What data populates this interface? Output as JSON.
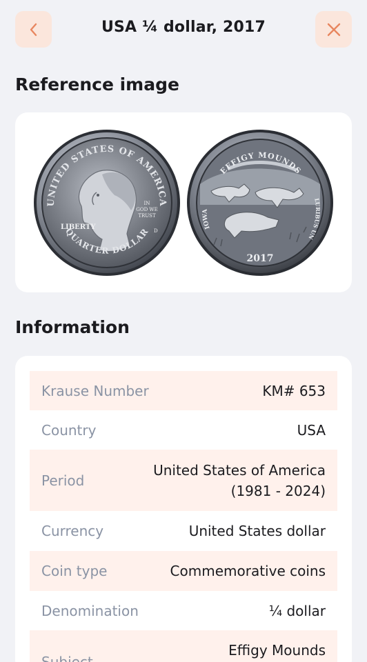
{
  "header": {
    "title": "USA ¼ dollar, 2017",
    "back_icon": "chevron-left-icon",
    "close_icon": "close-icon",
    "accent_color": "#e8865f"
  },
  "reference": {
    "section_title": "Reference image",
    "obverse": {
      "top_legend": "UNITED STATES OF AMERICA",
      "motto_1": "IN",
      "motto_2": "GOD WE",
      "motto_3": "TRUST",
      "liberty": "LIBERTY",
      "mint_mark": "D",
      "bottom_legend": "QUARTER DOLLAR"
    },
    "reverse": {
      "top_legend": "EFFIGY MOUNDS",
      "year": "2017",
      "left_legend": "IOWA",
      "right_legend": "E PLURIBUS UNUM"
    }
  },
  "information": {
    "section_title": "Information",
    "rows": [
      {
        "label": "Krause Number",
        "value": "KM# 653"
      },
      {
        "label": "Country",
        "value": "USA"
      },
      {
        "label": "Period",
        "value_line1": "United States of America",
        "value_line2": "(1981 - 2024)"
      },
      {
        "label": "Currency",
        "value": "United States dollar"
      },
      {
        "label": "Coin type",
        "value": "Commemorative coins"
      },
      {
        "label": "Denomination",
        "value": "¼ dollar"
      },
      {
        "label": "Subject",
        "value": "Effigy Mounds"
      }
    ]
  }
}
